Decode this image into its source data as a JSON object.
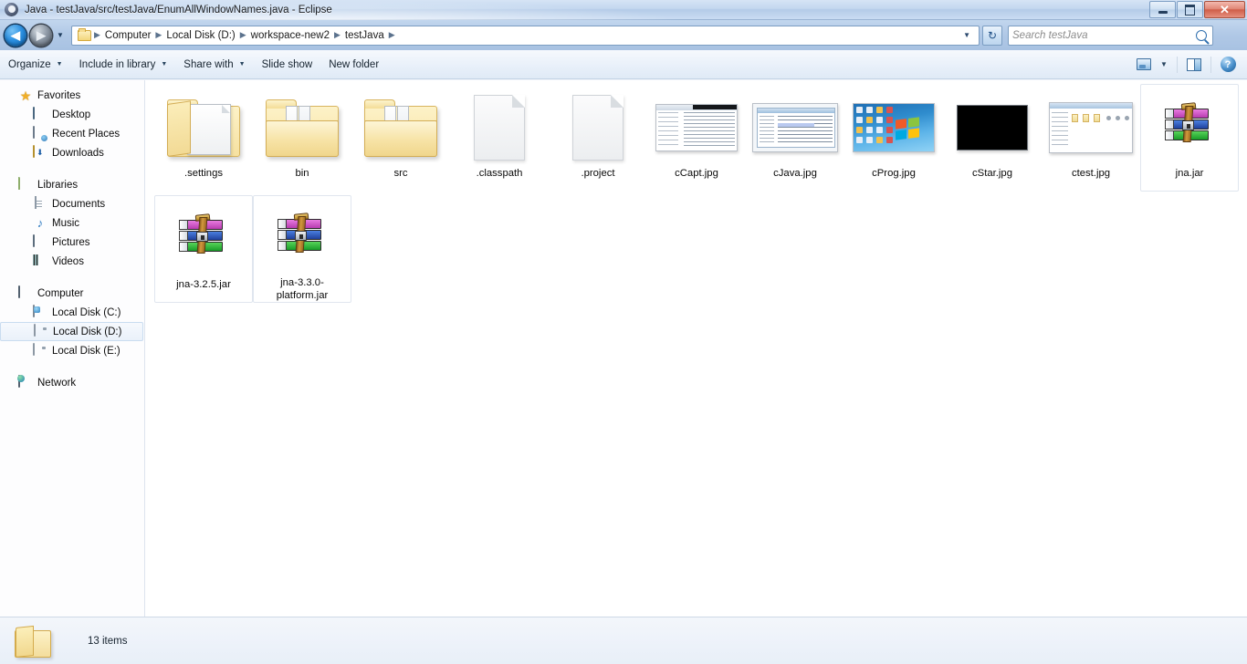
{
  "window": {
    "title": "Java - testJava/src/testJava/EnumAllWindowNames.java - Eclipse",
    "app_icon": "eclipse-icon",
    "controls": {
      "minimize": "–",
      "restore": "❐",
      "close": "✕"
    }
  },
  "navigation": {
    "back_label": "◀",
    "forward_label": "▶",
    "recent_dropdown": "▼",
    "refresh_label": "↻",
    "breadcrumb": [
      "Computer",
      "Local Disk (D:)",
      "workspace-new2",
      "testJava"
    ],
    "breadcrumb_separator": "▶",
    "breadcrumb_caret": "▼"
  },
  "search": {
    "placeholder": "Search testJava",
    "value": "",
    "icon": "search-icon"
  },
  "command_bar": {
    "items": [
      {
        "label": "Organize",
        "caret": "▼"
      },
      {
        "label": "Include in library",
        "caret": "▼"
      },
      {
        "label": "Share with",
        "caret": "▼"
      },
      {
        "label": "Slide show",
        "caret": ""
      },
      {
        "label": "New folder",
        "caret": ""
      }
    ],
    "view_caret": "▼",
    "help_label": "?"
  },
  "sidebar": {
    "groups": [
      {
        "header": {
          "label": "Favorites",
          "icon": "star-icon"
        },
        "items": [
          {
            "label": "Desktop",
            "icon": "desktop-icon"
          },
          {
            "label": "Recent Places",
            "icon": "recent-places-icon"
          },
          {
            "label": "Downloads",
            "icon": "downloads-icon"
          }
        ]
      },
      {
        "header": {
          "label": "Libraries",
          "icon": "libraries-icon"
        },
        "items": [
          {
            "label": "Documents",
            "icon": "documents-icon"
          },
          {
            "label": "Music",
            "icon": "music-icon"
          },
          {
            "label": "Pictures",
            "icon": "pictures-icon"
          },
          {
            "label": "Videos",
            "icon": "videos-icon"
          }
        ]
      },
      {
        "header": {
          "label": "Computer",
          "icon": "computer-icon"
        },
        "items": [
          {
            "label": "Local Disk (C:)",
            "icon": "local-disk-c-icon",
            "selected": false
          },
          {
            "label": "Local Disk (D:)",
            "icon": "local-disk-d-icon",
            "selected": true
          },
          {
            "label": "Local Disk (E:)",
            "icon": "local-disk-e-icon",
            "selected": false
          }
        ]
      },
      {
        "header": {
          "label": "Network",
          "icon": "network-icon"
        },
        "items": []
      }
    ]
  },
  "files": [
    {
      "name": ".settings",
      "icon": "folder-open-icon",
      "highlighted": false
    },
    {
      "name": "bin",
      "icon": "folder-docs-icon",
      "highlighted": false
    },
    {
      "name": "src",
      "icon": "folder-docs-icon",
      "highlighted": false
    },
    {
      "name": ".classpath",
      "icon": "blank-document-icon",
      "highlighted": false
    },
    {
      "name": ".project",
      "icon": "blank-document-icon",
      "highlighted": false
    },
    {
      "name": "cCapt.jpg",
      "icon": "photo-thumbnail",
      "highlighted": false
    },
    {
      "name": "cJava.jpg",
      "icon": "photo-thumbnail",
      "highlighted": false
    },
    {
      "name": "cProg.jpg",
      "icon": "photo-thumbnail",
      "highlighted": false
    },
    {
      "name": "cStar.jpg",
      "icon": "photo-thumbnail",
      "highlighted": false
    },
    {
      "name": "ctest.jpg",
      "icon": "photo-thumbnail",
      "highlighted": false
    },
    {
      "name": "jna.jar",
      "icon": "winrar-archive-icon",
      "highlighted": true
    },
    {
      "name": "jna-3.2.5.jar",
      "icon": "winrar-archive-icon",
      "highlighted": true
    },
    {
      "name": "jna-3.3.0-platform.jar",
      "icon": "winrar-archive-icon",
      "highlighted": true
    }
  ],
  "status": {
    "item_count": "13 items",
    "icon": "folder-icon"
  },
  "colors": {
    "accent": "#2b8fe0",
    "titlebar": "#b4cbe8",
    "close_button": "#cf5e49",
    "content_bg": "#ffffff",
    "sidebar_bg": "#fdfdfe"
  }
}
